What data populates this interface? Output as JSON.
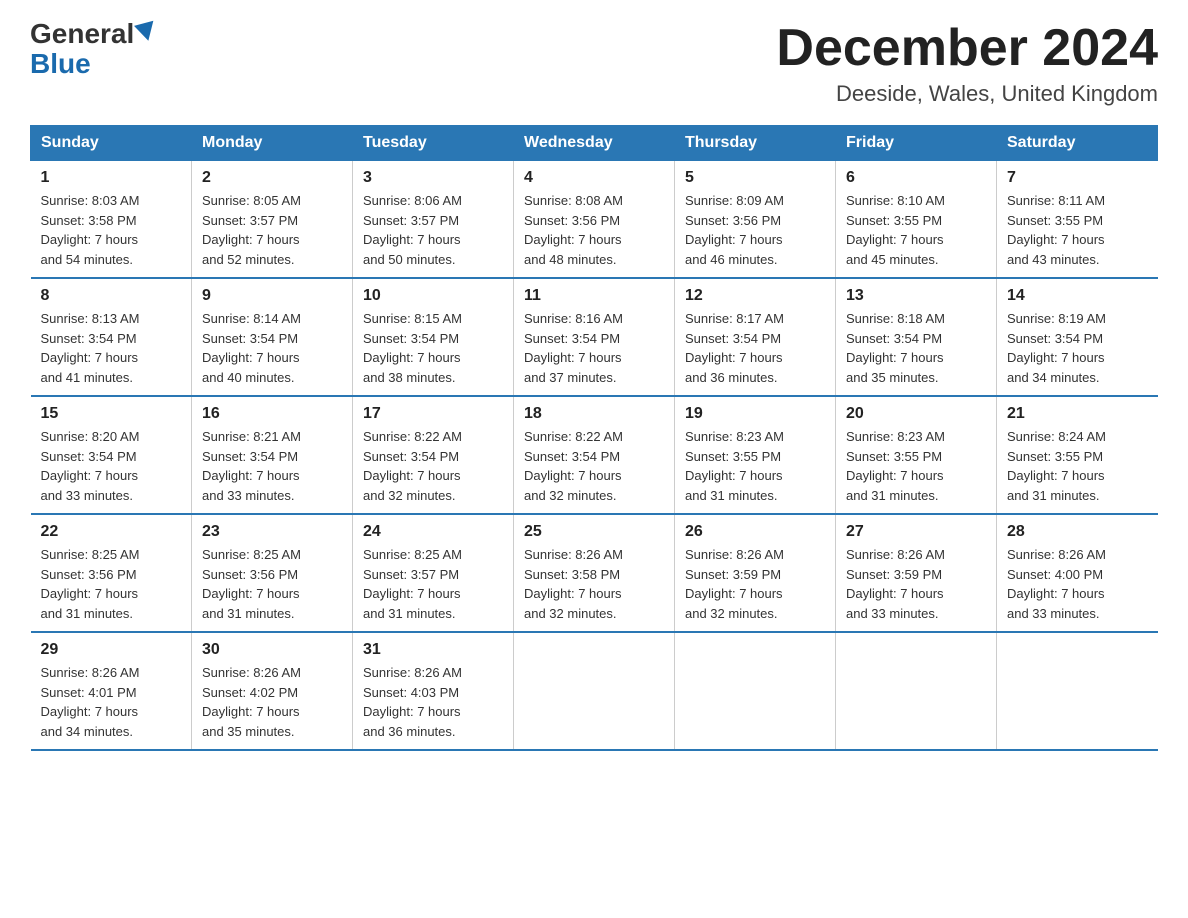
{
  "header": {
    "logo_general": "General",
    "logo_blue": "Blue",
    "month_title": "December 2024",
    "location": "Deeside, Wales, United Kingdom"
  },
  "weekdays": [
    "Sunday",
    "Monday",
    "Tuesday",
    "Wednesday",
    "Thursday",
    "Friday",
    "Saturday"
  ],
  "weeks": [
    [
      {
        "day": "1",
        "sunrise": "8:03 AM",
        "sunset": "3:58 PM",
        "daylight": "7 hours and 54 minutes."
      },
      {
        "day": "2",
        "sunrise": "8:05 AM",
        "sunset": "3:57 PM",
        "daylight": "7 hours and 52 minutes."
      },
      {
        "day": "3",
        "sunrise": "8:06 AM",
        "sunset": "3:57 PM",
        "daylight": "7 hours and 50 minutes."
      },
      {
        "day": "4",
        "sunrise": "8:08 AM",
        "sunset": "3:56 PM",
        "daylight": "7 hours and 48 minutes."
      },
      {
        "day": "5",
        "sunrise": "8:09 AM",
        "sunset": "3:56 PM",
        "daylight": "7 hours and 46 minutes."
      },
      {
        "day": "6",
        "sunrise": "8:10 AM",
        "sunset": "3:55 PM",
        "daylight": "7 hours and 45 minutes."
      },
      {
        "day": "7",
        "sunrise": "8:11 AM",
        "sunset": "3:55 PM",
        "daylight": "7 hours and 43 minutes."
      }
    ],
    [
      {
        "day": "8",
        "sunrise": "8:13 AM",
        "sunset": "3:54 PM",
        "daylight": "7 hours and 41 minutes."
      },
      {
        "day": "9",
        "sunrise": "8:14 AM",
        "sunset": "3:54 PM",
        "daylight": "7 hours and 40 minutes."
      },
      {
        "day": "10",
        "sunrise": "8:15 AM",
        "sunset": "3:54 PM",
        "daylight": "7 hours and 38 minutes."
      },
      {
        "day": "11",
        "sunrise": "8:16 AM",
        "sunset": "3:54 PM",
        "daylight": "7 hours and 37 minutes."
      },
      {
        "day": "12",
        "sunrise": "8:17 AM",
        "sunset": "3:54 PM",
        "daylight": "7 hours and 36 minutes."
      },
      {
        "day": "13",
        "sunrise": "8:18 AM",
        "sunset": "3:54 PM",
        "daylight": "7 hours and 35 minutes."
      },
      {
        "day": "14",
        "sunrise": "8:19 AM",
        "sunset": "3:54 PM",
        "daylight": "7 hours and 34 minutes."
      }
    ],
    [
      {
        "day": "15",
        "sunrise": "8:20 AM",
        "sunset": "3:54 PM",
        "daylight": "7 hours and 33 minutes."
      },
      {
        "day": "16",
        "sunrise": "8:21 AM",
        "sunset": "3:54 PM",
        "daylight": "7 hours and 33 minutes."
      },
      {
        "day": "17",
        "sunrise": "8:22 AM",
        "sunset": "3:54 PM",
        "daylight": "7 hours and 32 minutes."
      },
      {
        "day": "18",
        "sunrise": "8:22 AM",
        "sunset": "3:54 PM",
        "daylight": "7 hours and 32 minutes."
      },
      {
        "day": "19",
        "sunrise": "8:23 AM",
        "sunset": "3:55 PM",
        "daylight": "7 hours and 31 minutes."
      },
      {
        "day": "20",
        "sunrise": "8:23 AM",
        "sunset": "3:55 PM",
        "daylight": "7 hours and 31 minutes."
      },
      {
        "day": "21",
        "sunrise": "8:24 AM",
        "sunset": "3:55 PM",
        "daylight": "7 hours and 31 minutes."
      }
    ],
    [
      {
        "day": "22",
        "sunrise": "8:25 AM",
        "sunset": "3:56 PM",
        "daylight": "7 hours and 31 minutes."
      },
      {
        "day": "23",
        "sunrise": "8:25 AM",
        "sunset": "3:56 PM",
        "daylight": "7 hours and 31 minutes."
      },
      {
        "day": "24",
        "sunrise": "8:25 AM",
        "sunset": "3:57 PM",
        "daylight": "7 hours and 31 minutes."
      },
      {
        "day": "25",
        "sunrise": "8:26 AM",
        "sunset": "3:58 PM",
        "daylight": "7 hours and 32 minutes."
      },
      {
        "day": "26",
        "sunrise": "8:26 AM",
        "sunset": "3:59 PM",
        "daylight": "7 hours and 32 minutes."
      },
      {
        "day": "27",
        "sunrise": "8:26 AM",
        "sunset": "3:59 PM",
        "daylight": "7 hours and 33 minutes."
      },
      {
        "day": "28",
        "sunrise": "8:26 AM",
        "sunset": "4:00 PM",
        "daylight": "7 hours and 33 minutes."
      }
    ],
    [
      {
        "day": "29",
        "sunrise": "8:26 AM",
        "sunset": "4:01 PM",
        "daylight": "7 hours and 34 minutes."
      },
      {
        "day": "30",
        "sunrise": "8:26 AM",
        "sunset": "4:02 PM",
        "daylight": "7 hours and 35 minutes."
      },
      {
        "day": "31",
        "sunrise": "8:26 AM",
        "sunset": "4:03 PM",
        "daylight": "7 hours and 36 minutes."
      },
      null,
      null,
      null,
      null
    ]
  ],
  "labels": {
    "sunrise": "Sunrise:",
    "sunset": "Sunset:",
    "daylight": "Daylight:"
  }
}
